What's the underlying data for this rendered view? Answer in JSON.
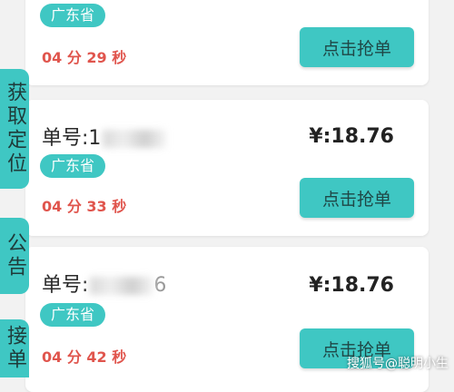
{
  "side_tabs": [
    {
      "label": "获取定位"
    },
    {
      "label": "公告"
    },
    {
      "label": "接单"
    }
  ],
  "orders": [
    {
      "province": "广东省",
      "countdown": "04 分 29 秒",
      "button_label": "点击抢单"
    },
    {
      "order_label": "单号:1",
      "price": "¥:18.76",
      "province": "广东省",
      "countdown": "04 分 33 秒",
      "button_label": "点击抢单"
    },
    {
      "order_label": "单号:",
      "order_suffix": "6",
      "price": "¥:18.76",
      "province": "广东省",
      "countdown": "04 分 42 秒",
      "button_label": "点击抢单"
    }
  ],
  "watermark": "搜狐号@聪明小生",
  "colors": {
    "accent": "#3fc7c3",
    "timer": "#e0554d",
    "background": "#f2f2f2"
  }
}
